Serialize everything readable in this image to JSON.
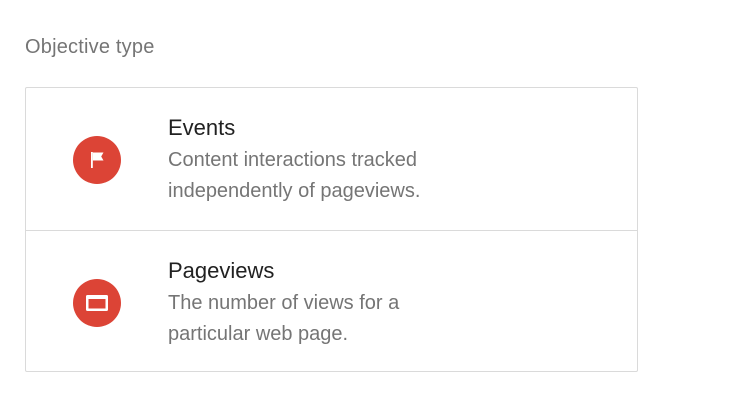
{
  "section_label": "Objective type",
  "colors": {
    "icon_background": "#dc4436",
    "title_text": "#212121",
    "secondary_text": "#757575",
    "divider": "#dadada"
  },
  "options": [
    {
      "title": "Events",
      "description": "Content interactions tracked\nindependently of pageviews.",
      "icon": "flag-icon"
    },
    {
      "title": "Pageviews",
      "description": "The number of views for a\nparticular web page.",
      "icon": "browser-window-icon"
    }
  ]
}
